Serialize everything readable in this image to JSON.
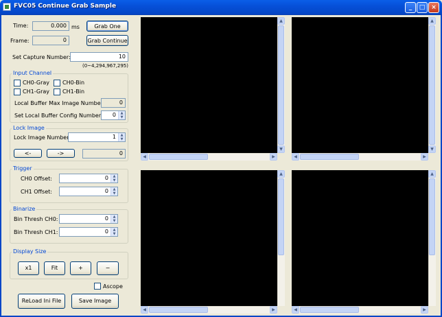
{
  "window": {
    "title": "FVC05 Continue Grab Sample"
  },
  "controls": {
    "time_label": "Time:",
    "time_value": "0.000",
    "time_unit": "ms",
    "frame_label": "Frame:",
    "frame_value": "0",
    "grab_one": "Grab One",
    "grab_continue": "Grab Continue",
    "capture_label": "Set Capture Number:",
    "capture_value": "10",
    "capture_range": "(0~4,294,967,295)"
  },
  "input_channel": {
    "title": "Input Channel",
    "ch0_gray": "CH0-Gray",
    "ch0_bin": "CH0-Bin",
    "ch1_gray": "CH1-Gray",
    "ch1_bin": "CH1-Bin",
    "max_label": "Local Buffer Max Image Number:",
    "max_value": "0",
    "config_label": "Set Local Buffer Config Number:",
    "config_value": "0"
  },
  "lock_image": {
    "title": "Lock Image",
    "number_label": "Lock Image Number:",
    "number_value": "1",
    "prev": "<-",
    "next": "->",
    "value": "0"
  },
  "trigger": {
    "title": "Trigger",
    "ch0_label": "CH0 Offset:",
    "ch0_value": "0",
    "ch1_label": "CH1 Offset:",
    "ch1_value": "0"
  },
  "binarize": {
    "title": "Binarize",
    "ch0_label": "Bin Thresh CH0:",
    "ch0_value": "0",
    "ch1_label": "Bin Thresh CH1:",
    "ch1_value": "0"
  },
  "display_size": {
    "title": "Display Size",
    "x1": "x1",
    "fit": "Fit",
    "plus": "+",
    "minus": "−"
  },
  "ascope_label": "Ascope",
  "reload_button": "ReLoad Ini File",
  "save_button": "Save Image",
  "icons": {
    "minimize": "minimize-icon",
    "maximize": "maximize-icon",
    "close": "close-icon",
    "scroll_up": "▲",
    "scroll_down": "▼",
    "scroll_left": "◀",
    "scroll_right": "▶"
  }
}
